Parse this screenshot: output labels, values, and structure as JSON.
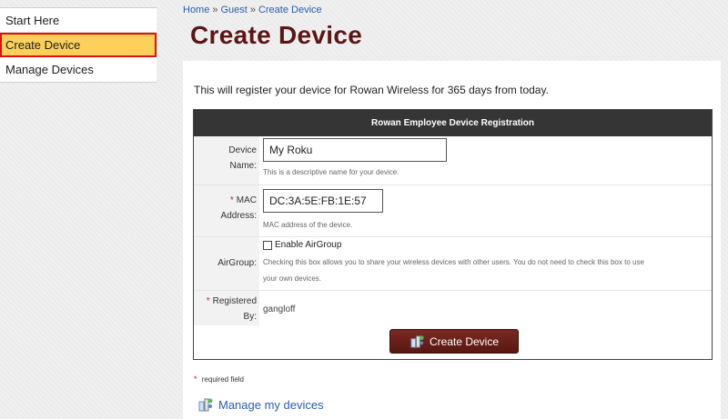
{
  "sidebar": {
    "items": [
      {
        "label": "Start Here"
      },
      {
        "label": "Create Device"
      },
      {
        "label": "Manage Devices"
      }
    ]
  },
  "breadcrumb": {
    "home": "Home",
    "guest": "Guest",
    "current": "Create Device",
    "separator": "»"
  },
  "page": {
    "title": "Create Device",
    "intro": "This will register your device for Rowan Wireless for 365 days from today."
  },
  "form": {
    "header": "Rowan Employee Device Registration",
    "device_name": {
      "label_line1": "Device",
      "label_line2": "Name:",
      "value": "My Roku",
      "hint": "This is a descriptive name for your device."
    },
    "mac": {
      "required_mark": "*",
      "label_line1": "MAC",
      "label_line2": "Address:",
      "value": "DC:3A:5E:FB:1E:57",
      "hint": "MAC address of the device."
    },
    "airgroup": {
      "label": "AirGroup:",
      "checkbox_label": "Enable AirGroup",
      "checked": false,
      "hint_line1": "Checking this box allows you to share your wireless devices with other users. You do not need to check this box to use",
      "hint_line2": "your own devices."
    },
    "registered_by": {
      "required_mark": "*",
      "label_line1": "Registered",
      "label_line2": "By:",
      "value": "gangloff"
    },
    "submit_label": "Create Device"
  },
  "footer": {
    "required_mark": "*",
    "required_note": "required field",
    "manage_link": "Manage my devices"
  },
  "colors": {
    "title": "#5c1616",
    "active_sidebar_bg": "#fdd159",
    "active_sidebar_border": "#e01010",
    "form_header_bg": "#353535",
    "button_bg": "#6b1f1a",
    "link": "#2a5db0"
  },
  "icons": {
    "button_icon": "device-network-icon",
    "manage_icon": "device-network-icon"
  }
}
